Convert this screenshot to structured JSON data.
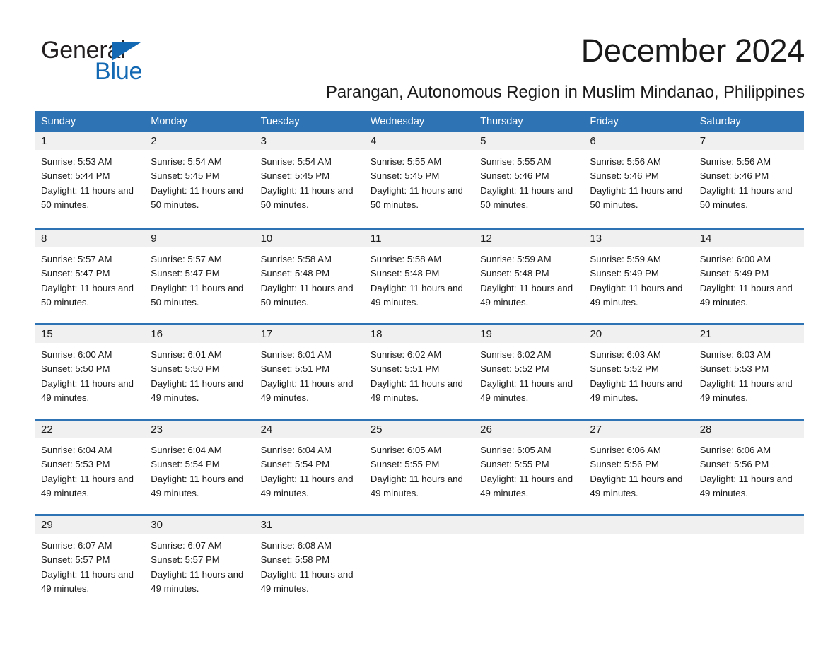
{
  "brand": {
    "name_part1": "General",
    "name_part2": "Blue",
    "triangle_color": "#1268b3",
    "text_color": "#231f20"
  },
  "header": {
    "month_title": "December 2024",
    "location": "Parangan, Autonomous Region in Muslim Mindanao, Philippines"
  },
  "theme": {
    "header_blue": "#2e74b5",
    "daynum_band": "#f0f0f0",
    "text": "#1a1a1a"
  },
  "calendar": {
    "weekdays": [
      "Sunday",
      "Monday",
      "Tuesday",
      "Wednesday",
      "Thursday",
      "Friday",
      "Saturday"
    ],
    "weeks": [
      [
        {
          "day": "1",
          "sunrise": "Sunrise: 5:53 AM",
          "sunset": "Sunset: 5:44 PM",
          "daylight": "Daylight: 11 hours and 50 minutes."
        },
        {
          "day": "2",
          "sunrise": "Sunrise: 5:54 AM",
          "sunset": "Sunset: 5:45 PM",
          "daylight": "Daylight: 11 hours and 50 minutes."
        },
        {
          "day": "3",
          "sunrise": "Sunrise: 5:54 AM",
          "sunset": "Sunset: 5:45 PM",
          "daylight": "Daylight: 11 hours and 50 minutes."
        },
        {
          "day": "4",
          "sunrise": "Sunrise: 5:55 AM",
          "sunset": "Sunset: 5:45 PM",
          "daylight": "Daylight: 11 hours and 50 minutes."
        },
        {
          "day": "5",
          "sunrise": "Sunrise: 5:55 AM",
          "sunset": "Sunset: 5:46 PM",
          "daylight": "Daylight: 11 hours and 50 minutes."
        },
        {
          "day": "6",
          "sunrise": "Sunrise: 5:56 AM",
          "sunset": "Sunset: 5:46 PM",
          "daylight": "Daylight: 11 hours and 50 minutes."
        },
        {
          "day": "7",
          "sunrise": "Sunrise: 5:56 AM",
          "sunset": "Sunset: 5:46 PM",
          "daylight": "Daylight: 11 hours and 50 minutes."
        }
      ],
      [
        {
          "day": "8",
          "sunrise": "Sunrise: 5:57 AM",
          "sunset": "Sunset: 5:47 PM",
          "daylight": "Daylight: 11 hours and 50 minutes."
        },
        {
          "day": "9",
          "sunrise": "Sunrise: 5:57 AM",
          "sunset": "Sunset: 5:47 PM",
          "daylight": "Daylight: 11 hours and 50 minutes."
        },
        {
          "day": "10",
          "sunrise": "Sunrise: 5:58 AM",
          "sunset": "Sunset: 5:48 PM",
          "daylight": "Daylight: 11 hours and 50 minutes."
        },
        {
          "day": "11",
          "sunrise": "Sunrise: 5:58 AM",
          "sunset": "Sunset: 5:48 PM",
          "daylight": "Daylight: 11 hours and 49 minutes."
        },
        {
          "day": "12",
          "sunrise": "Sunrise: 5:59 AM",
          "sunset": "Sunset: 5:48 PM",
          "daylight": "Daylight: 11 hours and 49 minutes."
        },
        {
          "day": "13",
          "sunrise": "Sunrise: 5:59 AM",
          "sunset": "Sunset: 5:49 PM",
          "daylight": "Daylight: 11 hours and 49 minutes."
        },
        {
          "day": "14",
          "sunrise": "Sunrise: 6:00 AM",
          "sunset": "Sunset: 5:49 PM",
          "daylight": "Daylight: 11 hours and 49 minutes."
        }
      ],
      [
        {
          "day": "15",
          "sunrise": "Sunrise: 6:00 AM",
          "sunset": "Sunset: 5:50 PM",
          "daylight": "Daylight: 11 hours and 49 minutes."
        },
        {
          "day": "16",
          "sunrise": "Sunrise: 6:01 AM",
          "sunset": "Sunset: 5:50 PM",
          "daylight": "Daylight: 11 hours and 49 minutes."
        },
        {
          "day": "17",
          "sunrise": "Sunrise: 6:01 AM",
          "sunset": "Sunset: 5:51 PM",
          "daylight": "Daylight: 11 hours and 49 minutes."
        },
        {
          "day": "18",
          "sunrise": "Sunrise: 6:02 AM",
          "sunset": "Sunset: 5:51 PM",
          "daylight": "Daylight: 11 hours and 49 minutes."
        },
        {
          "day": "19",
          "sunrise": "Sunrise: 6:02 AM",
          "sunset": "Sunset: 5:52 PM",
          "daylight": "Daylight: 11 hours and 49 minutes."
        },
        {
          "day": "20",
          "sunrise": "Sunrise: 6:03 AM",
          "sunset": "Sunset: 5:52 PM",
          "daylight": "Daylight: 11 hours and 49 minutes."
        },
        {
          "day": "21",
          "sunrise": "Sunrise: 6:03 AM",
          "sunset": "Sunset: 5:53 PM",
          "daylight": "Daylight: 11 hours and 49 minutes."
        }
      ],
      [
        {
          "day": "22",
          "sunrise": "Sunrise: 6:04 AM",
          "sunset": "Sunset: 5:53 PM",
          "daylight": "Daylight: 11 hours and 49 minutes."
        },
        {
          "day": "23",
          "sunrise": "Sunrise: 6:04 AM",
          "sunset": "Sunset: 5:54 PM",
          "daylight": "Daylight: 11 hours and 49 minutes."
        },
        {
          "day": "24",
          "sunrise": "Sunrise: 6:04 AM",
          "sunset": "Sunset: 5:54 PM",
          "daylight": "Daylight: 11 hours and 49 minutes."
        },
        {
          "day": "25",
          "sunrise": "Sunrise: 6:05 AM",
          "sunset": "Sunset: 5:55 PM",
          "daylight": "Daylight: 11 hours and 49 minutes."
        },
        {
          "day": "26",
          "sunrise": "Sunrise: 6:05 AM",
          "sunset": "Sunset: 5:55 PM",
          "daylight": "Daylight: 11 hours and 49 minutes."
        },
        {
          "day": "27",
          "sunrise": "Sunrise: 6:06 AM",
          "sunset": "Sunset: 5:56 PM",
          "daylight": "Daylight: 11 hours and 49 minutes."
        },
        {
          "day": "28",
          "sunrise": "Sunrise: 6:06 AM",
          "sunset": "Sunset: 5:56 PM",
          "daylight": "Daylight: 11 hours and 49 minutes."
        }
      ],
      [
        {
          "day": "29",
          "sunrise": "Sunrise: 6:07 AM",
          "sunset": "Sunset: 5:57 PM",
          "daylight": "Daylight: 11 hours and 49 minutes."
        },
        {
          "day": "30",
          "sunrise": "Sunrise: 6:07 AM",
          "sunset": "Sunset: 5:57 PM",
          "daylight": "Daylight: 11 hours and 49 minutes."
        },
        {
          "day": "31",
          "sunrise": "Sunrise: 6:08 AM",
          "sunset": "Sunset: 5:58 PM",
          "daylight": "Daylight: 11 hours and 49 minutes."
        },
        {
          "day": "",
          "sunrise": "",
          "sunset": "",
          "daylight": ""
        },
        {
          "day": "",
          "sunrise": "",
          "sunset": "",
          "daylight": ""
        },
        {
          "day": "",
          "sunrise": "",
          "sunset": "",
          "daylight": ""
        },
        {
          "day": "",
          "sunrise": "",
          "sunset": "",
          "daylight": ""
        }
      ]
    ]
  }
}
